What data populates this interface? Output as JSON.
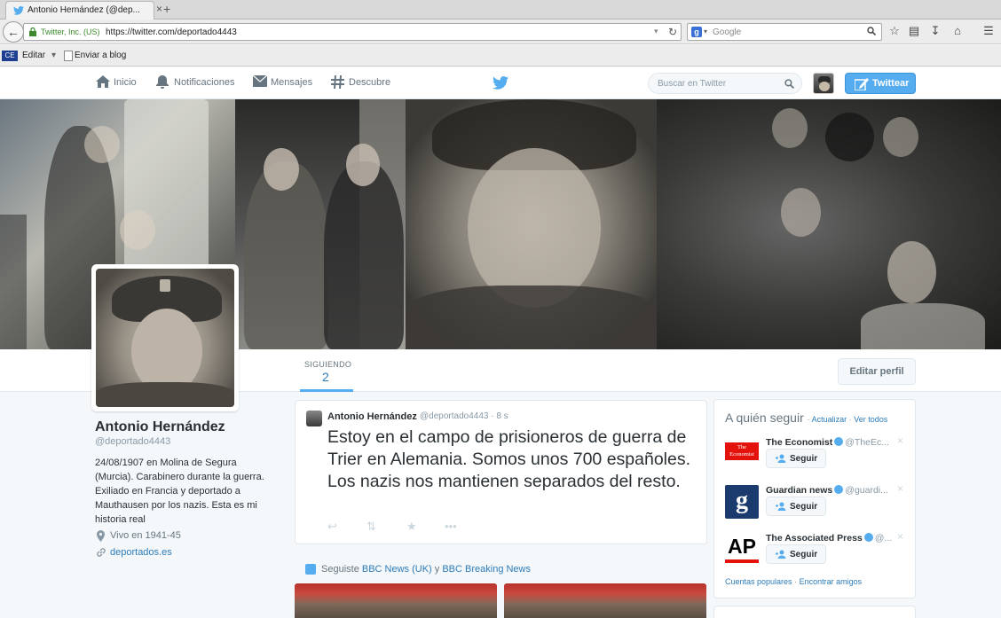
{
  "browser": {
    "tab_title": "Antonio Hernández (@dep...",
    "tab_close": "×",
    "tab_new": "+",
    "url_org": "Twitter, Inc. (US)",
    "url": "https://twitter.com/deportado4443",
    "search_placeholder": "Google",
    "search_engine_badge": "g",
    "bookmarks": {
      "editar": "Editar",
      "enviar": "Enviar a blog"
    }
  },
  "twitter_nav": {
    "inicio": "Inicio",
    "notificaciones": "Notificaciones",
    "mensajes": "Mensajes",
    "descubre": "Descubre",
    "search_placeholder": "Buscar en Twitter",
    "tweet_button": "Twittear"
  },
  "profile": {
    "name": "Antonio Hernández",
    "handle": "@deportado4443",
    "bio": "24/08/1907 en Molina de Segura (Murcia). Carabinero durante la guerra. Exiliado en Francia y deportado a Mauthausen por los nazis. Esta es mi historia real",
    "location": "Vivo en 1941-45",
    "website": "deportados.es",
    "stat_label": "SIGUIENDO",
    "stat_value": "2",
    "edit_button": "Editar perfil"
  },
  "tweet": {
    "name": "Antonio Hernández",
    "handle": "@deportado4443",
    "time": "· 8 s",
    "text": "Estoy en el campo de prisioneros de guerra de Trier en Alemania. Somos unos 700 españoles. Los nazis nos mantienen separados del resto."
  },
  "follow_notice": {
    "prefix": "Seguiste",
    "account1": "BBC News (UK)",
    "joiner": "y",
    "account2": "BBC Breaking News"
  },
  "who_to_follow": {
    "title": "A quién seguir",
    "actualizar": "Actualizar",
    "ver_todos": "Ver todos",
    "follow_label": "Seguir",
    "items": [
      {
        "name": "The Economist",
        "handle": "@TheEc..."
      },
      {
        "name": "Guardian news",
        "handle": "@guardi..."
      },
      {
        "name": "The Associated Press",
        "handle": "@..."
      }
    ],
    "logo_texts": {
      "economist": "The Economist",
      "guardian": "g",
      "ap": "AP"
    },
    "footer_popular": "Cuentas populares",
    "footer_find": "Encontrar amigos"
  },
  "colors": {
    "accent": "#55acee",
    "link": "#2b7bb9"
  }
}
